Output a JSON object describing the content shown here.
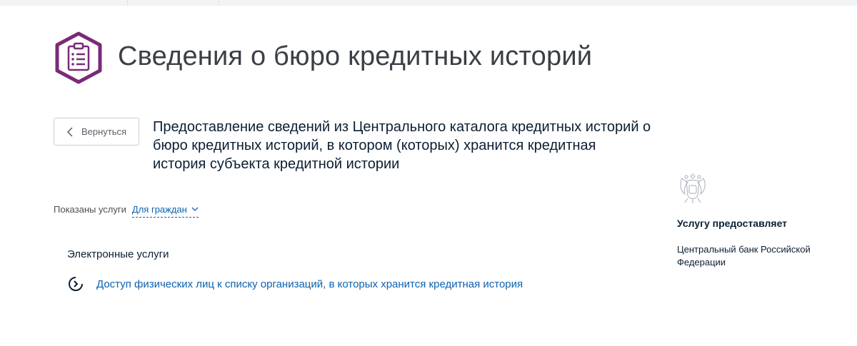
{
  "header": {
    "icon": "clipboard-list-icon",
    "title": "Сведения о бюро кредитных историй"
  },
  "nav": {
    "back_label": "Вернуться"
  },
  "service": {
    "title": "Предоставление сведений из Центрального каталога кредитных историй о бюро кредитных историй, в котором (которых) хранится кредитная история субъекта кредитной истории"
  },
  "filter": {
    "label": "Показаны услуги",
    "selected": "Для граждан"
  },
  "electronic_services": {
    "heading": "Электронные услуги",
    "items": [
      {
        "label": "Доступ физических лиц к списку организаций, в которых хранится кредитная история",
        "icon": "circle-arrow-right-icon"
      }
    ]
  },
  "provider": {
    "heading": "Услугу предоставляет",
    "name": "Центральный банк Российской Федерации",
    "emblem": "coat-of-arms-icon"
  },
  "colors": {
    "accent": "#7a2a78",
    "link": "#0d62b0",
    "text": "#0b1f33",
    "muted": "#5b6066"
  }
}
